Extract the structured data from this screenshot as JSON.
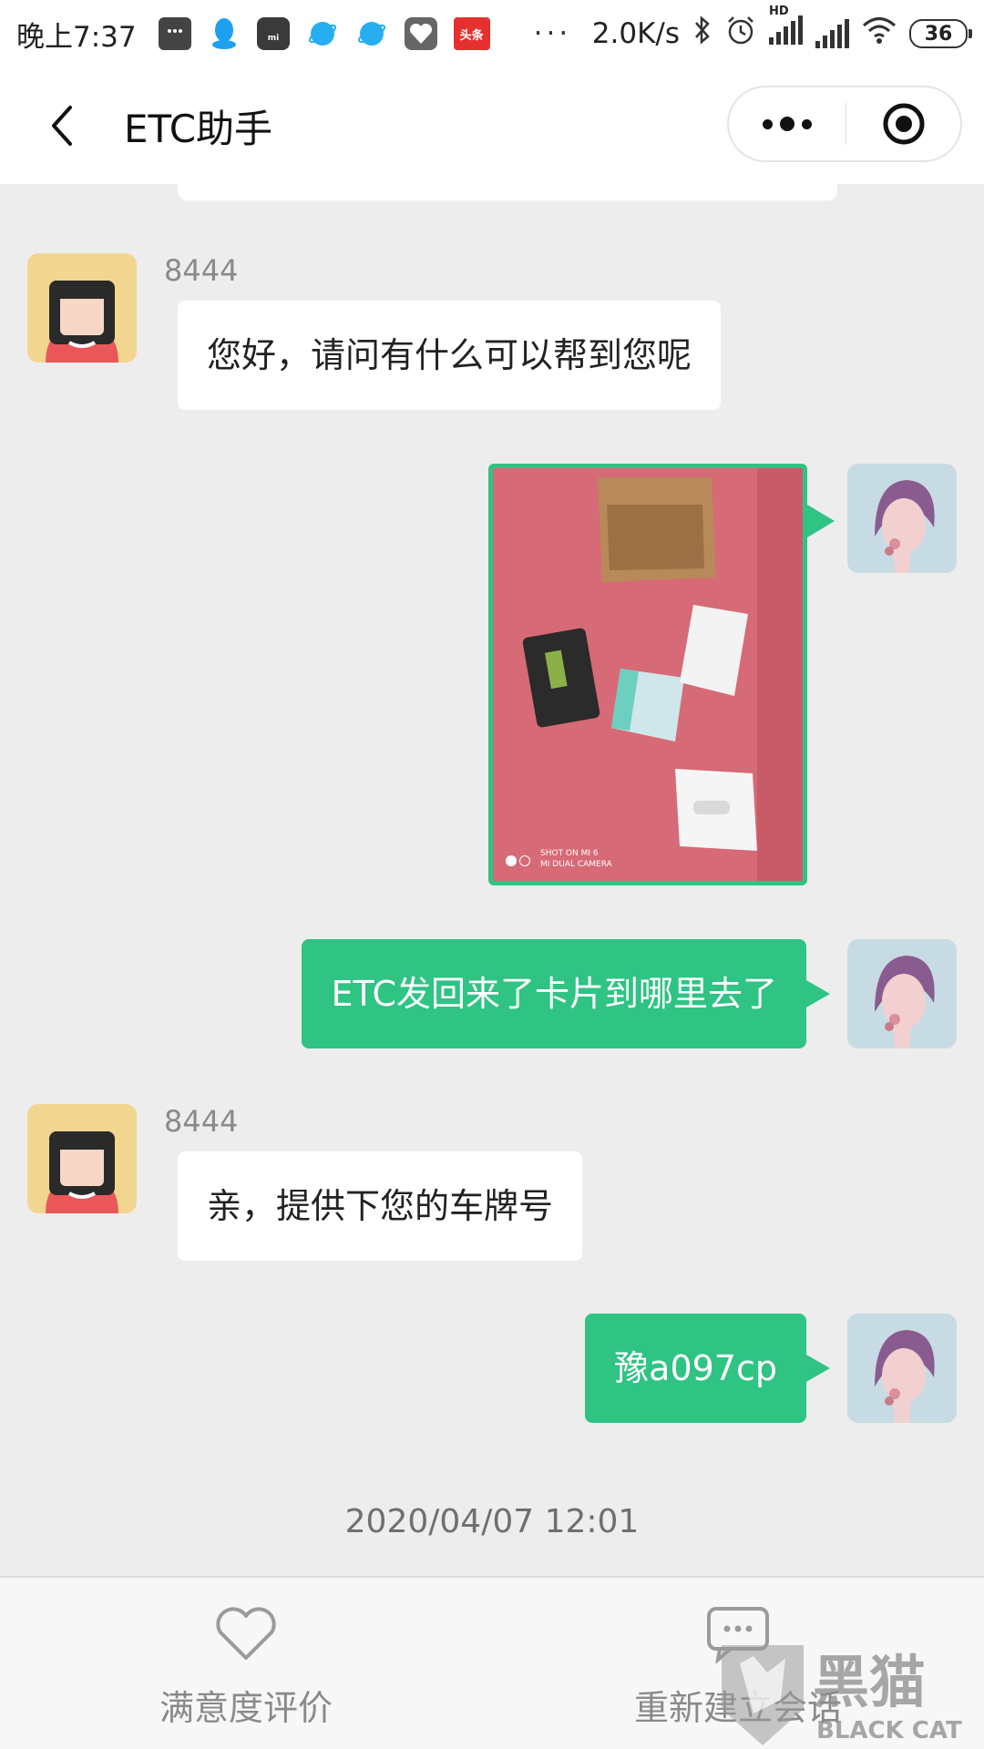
{
  "status_bar": {
    "time": "晚上7:37",
    "network_speed": "2.0K/s",
    "battery": "36",
    "toutiao_label": "头条",
    "signal_hd": "HD",
    "overflow_dots": "···"
  },
  "nav": {
    "title": "ETC助手"
  },
  "messages": [
    {
      "side": "in",
      "sender": "8444",
      "text": "您好，请问有什么可以帮到您呢"
    },
    {
      "side": "out",
      "type": "image",
      "caption_line1": "SHOT ON MI 6",
      "caption_line2": "MI DUAL CAMERA"
    },
    {
      "side": "out",
      "text": "ETC发回来了卡片到哪里去了"
    },
    {
      "side": "in",
      "sender": "8444",
      "text": "亲，提供下您的车牌号"
    },
    {
      "side": "out",
      "text": "豫a097cp"
    }
  ],
  "timestamp": "2020/04/07 12:01",
  "bottom_bar": {
    "rate_label": "满意度评价",
    "new_session_label": "重新建立会话"
  },
  "watermark": {
    "cn": "黑猫",
    "en": "BLACK CAT"
  },
  "colors": {
    "accent_green": "#2fc384",
    "chat_bg": "#ededed"
  }
}
